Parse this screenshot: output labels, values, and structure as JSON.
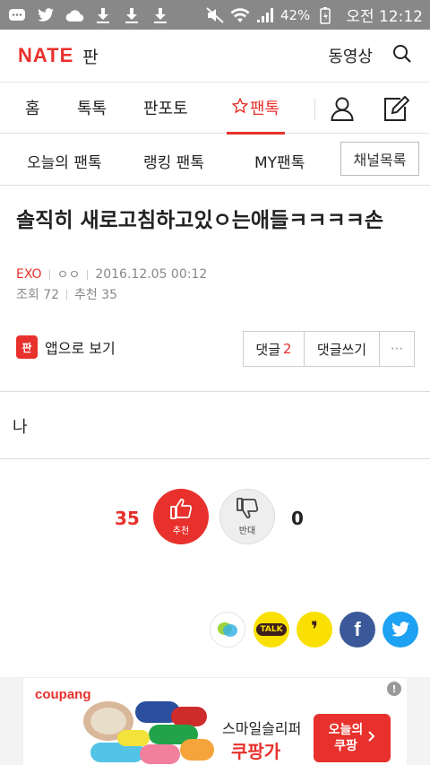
{
  "statusbar": {
    "battery": "42%",
    "time": "오전 12:12"
  },
  "header": {
    "logo": "NATE",
    "section": "판",
    "video_label": "동영상"
  },
  "tabs": [
    {
      "label": "홈"
    },
    {
      "label": "톡톡"
    },
    {
      "label": "판포토"
    },
    {
      "label": "팬톡"
    }
  ],
  "subnav": {
    "items": [
      "오늘의 팬톡",
      "랭킹 팬톡",
      "MY팬톡"
    ],
    "channel_button": "채널목록"
  },
  "post": {
    "title": "솔직히 새로고침하고있ㅇ는애들ㅋㅋㅋㅋ손",
    "channel": "EXO",
    "author": "ㅇㅇ",
    "date": "2016.12.05 00:12",
    "views": "조회 72",
    "recommends": "추천 35",
    "app_view": "앱으로 보기",
    "app_icon_text": "판",
    "comment_label": "댓글",
    "comment_count": "2",
    "write_comment": "댓글쓰기",
    "more": "···",
    "body": "나"
  },
  "votes": {
    "up_count": "35",
    "up_label": "추천",
    "down_count": "0",
    "down_label": "반대"
  },
  "share": {
    "kakaotalk": "TALK",
    "kakaostory": "❜",
    "facebook": "f"
  },
  "ad": {
    "brand": "coupang",
    "text1": "스마일슬리퍼",
    "text2": "쿠팡가",
    "cta": "오늘의\n쿠팡",
    "info": "!"
  },
  "colors": {
    "accent": "#e8312c",
    "facebook": "#3b5998",
    "twitter": "#1da1f2",
    "kakao": "#f9e000"
  }
}
